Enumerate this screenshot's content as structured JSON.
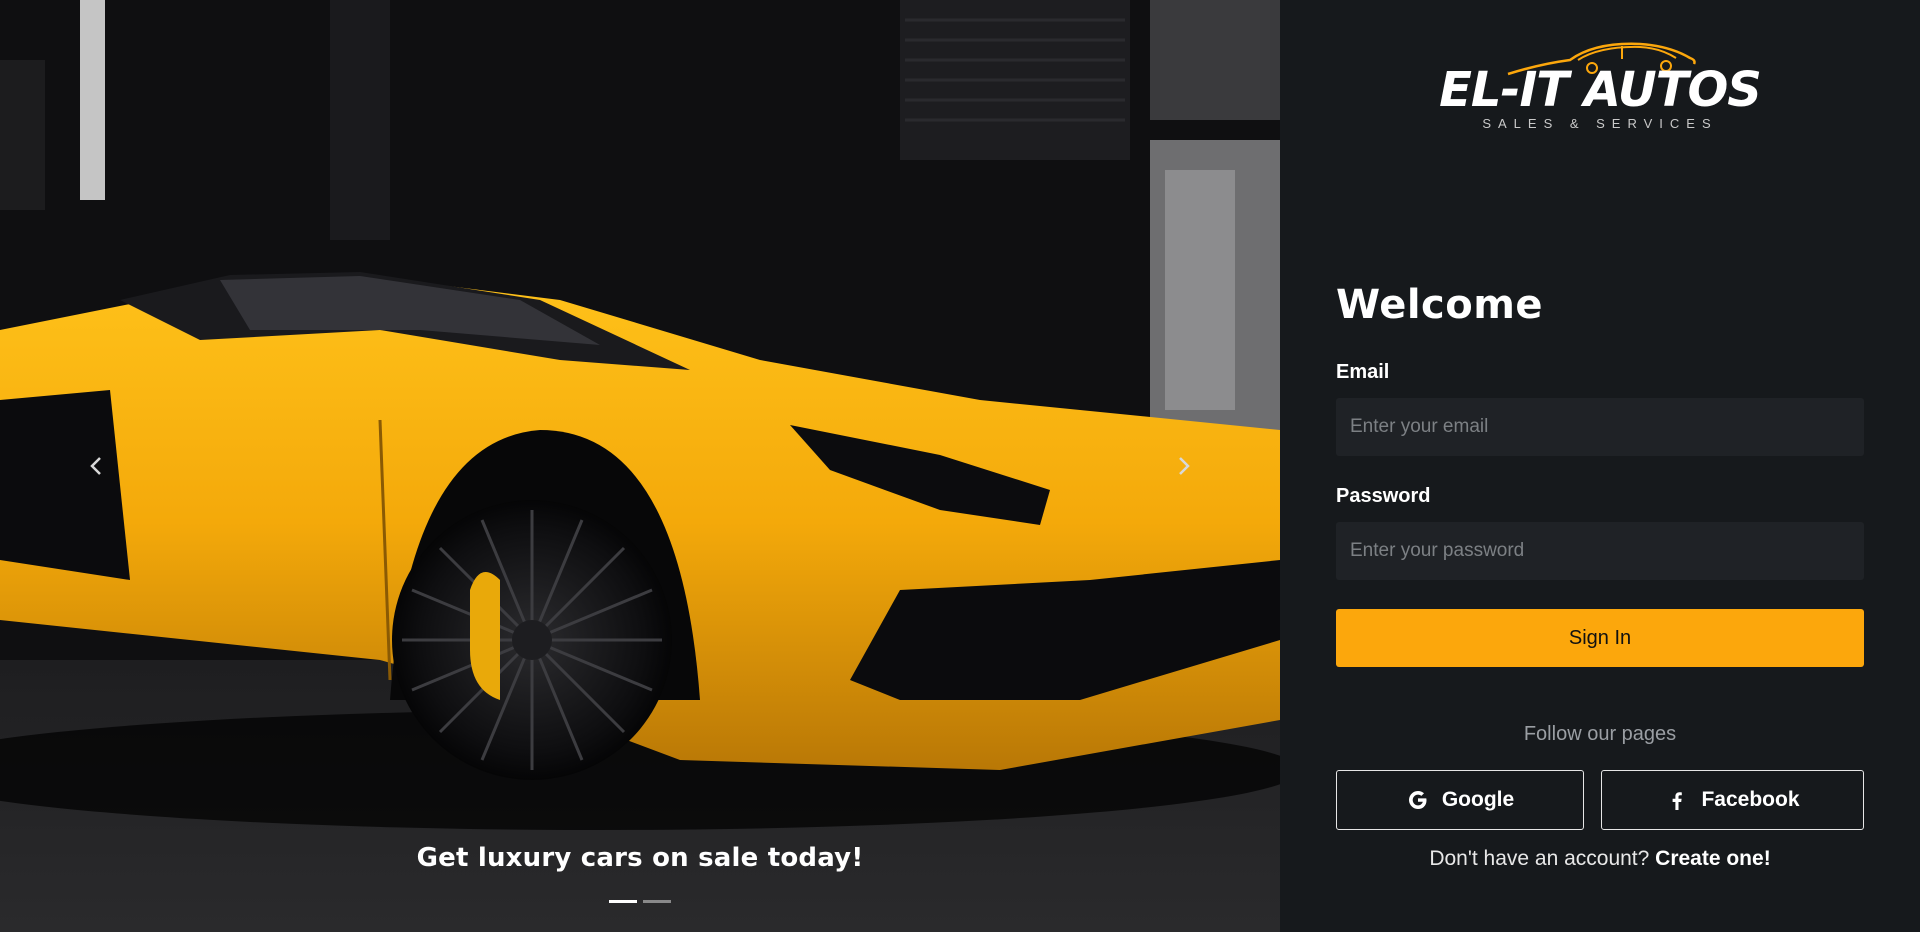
{
  "hero": {
    "caption": "Get luxury cars on sale today!",
    "slide_count": 2,
    "active_slide": 1,
    "car_color": "#f4a90a"
  },
  "brand": {
    "name": "EL-IT AUTOS",
    "tagline": "SALES & SERVICES",
    "accent": "#fca70c"
  },
  "form": {
    "title": "Welcome",
    "email_label": "Email",
    "email_placeholder": "Enter your email",
    "email_value": "",
    "password_label": "Password",
    "password_placeholder": "Enter your password",
    "password_value": "",
    "submit_label": "Sign In"
  },
  "social": {
    "heading": "Follow our pages",
    "google_label": "Google",
    "google_icon": "google-icon",
    "facebook_label": "Facebook",
    "facebook_icon": "facebook-icon"
  },
  "signup": {
    "prompt": "Don't have an account?",
    "link": "Create one!"
  }
}
